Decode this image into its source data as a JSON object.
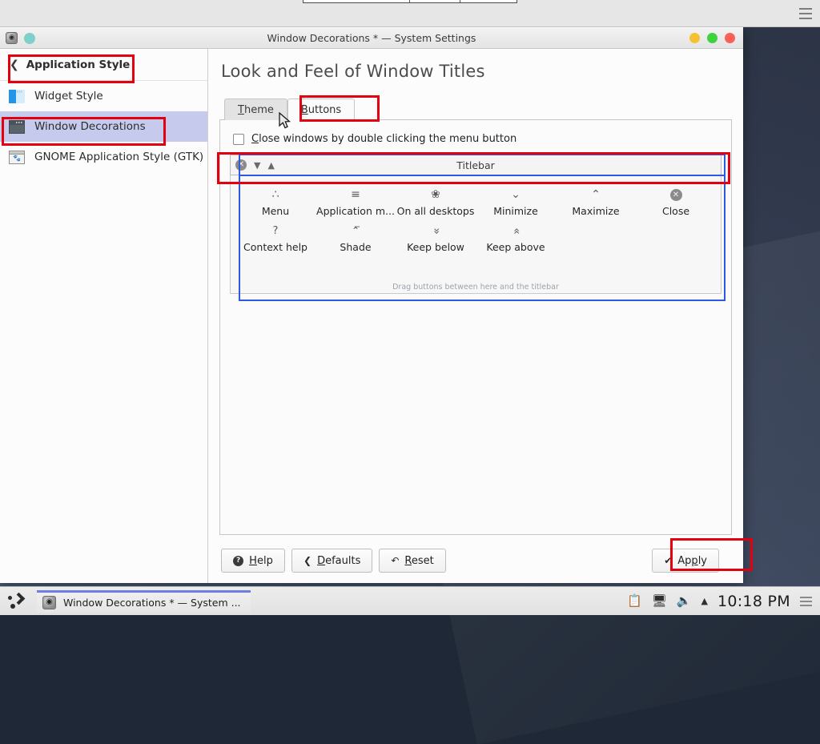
{
  "window": {
    "title": "Window Decorations * — System Settings",
    "app_icon": "settings-gear-icon",
    "controls": {
      "minimize": "#f5c132",
      "maximize": "#3ed33e",
      "close": "#fa6055"
    },
    "pill_color": "#7ed0cd"
  },
  "sidebar": {
    "header": {
      "back_icon": "chevron-left-icon",
      "label": "Application Style"
    },
    "items": [
      {
        "label": "Widget Style",
        "icon": "widget-style-icon",
        "selected": false
      },
      {
        "label": "Window Decorations",
        "icon": "window-decorations-icon",
        "selected": true
      },
      {
        "label": "GNOME Application Style (GTK)",
        "icon": "gnome-style-icon",
        "selected": false
      }
    ]
  },
  "content": {
    "page_title": "Look and Feel of Window Titles",
    "tabs": [
      {
        "label": "Theme",
        "mnemonic": "T",
        "active": false
      },
      {
        "label": "Buttons",
        "mnemonic": "B",
        "active": true
      }
    ],
    "checkbox": {
      "label_before": "",
      "mnemonic": "C",
      "label_after": "lose windows by double clicking the menu button",
      "checked": false
    },
    "preview_titlebar": {
      "name": "Titlebar",
      "buttons": [
        "close-icon",
        "chevron-down-icon",
        "chevron-up-icon"
      ]
    },
    "dropzone": {
      "hint": "Drag buttons between here and the titlebar",
      "row1": [
        {
          "caption": "Menu",
          "icon": "menu-dots-icon",
          "glyph": "∴"
        },
        {
          "caption": "Application m...",
          "full": "Application menu",
          "icon": "hamburger-icon",
          "glyph": "≡"
        },
        {
          "caption": "On all desktops",
          "icon": "pin-icon",
          "glyph": "✐"
        },
        {
          "caption": "Minimize",
          "icon": "chevron-down-icon",
          "glyph": "⌄"
        },
        {
          "caption": "Maximize",
          "icon": "chevron-up-icon",
          "glyph": "⌃"
        },
        {
          "caption": "Close",
          "icon": "close-circle-icon",
          "glyph": "×"
        }
      ],
      "row2": [
        {
          "caption": "Context help",
          "icon": "question-mark-icon",
          "glyph": "?"
        },
        {
          "caption": "Shade",
          "icon": "shade-icon",
          "glyph": "̅⌃"
        },
        {
          "caption": "Keep below",
          "icon": "double-chevron-down-icon",
          "glyph": "»"
        },
        {
          "caption": "Keep above",
          "icon": "double-chevron-up-icon",
          "glyph": "«"
        }
      ]
    }
  },
  "actions": [
    {
      "label_before": "",
      "mnemonic": "H",
      "label_after": "elp",
      "icon": "help-circle-icon",
      "name": "help"
    },
    {
      "label_before": "",
      "mnemonic": "D",
      "label_after": "efaults",
      "icon": "chevron-left-icon",
      "name": "defaults"
    },
    {
      "label_before": "",
      "mnemonic": "R",
      "label_after": "eset",
      "icon": "undo-arrow-icon",
      "name": "reset"
    }
  ],
  "apply": {
    "label_before": "Ap",
    "mnemonic": "p",
    "label_after": "ly",
    "icon": "checkmark-icon"
  },
  "taskbar": {
    "launcher_icon": "kde-launcher-icon",
    "entry": {
      "title": "Window Decorations * — System ...",
      "icon": "settings-gear-icon"
    },
    "tray": [
      "clipboard-icon",
      "network-icon",
      "volume-icon",
      "show-hidden-arrow-icon"
    ],
    "clock": "10:18 PM",
    "menu_icon": "hamburger-icon"
  }
}
